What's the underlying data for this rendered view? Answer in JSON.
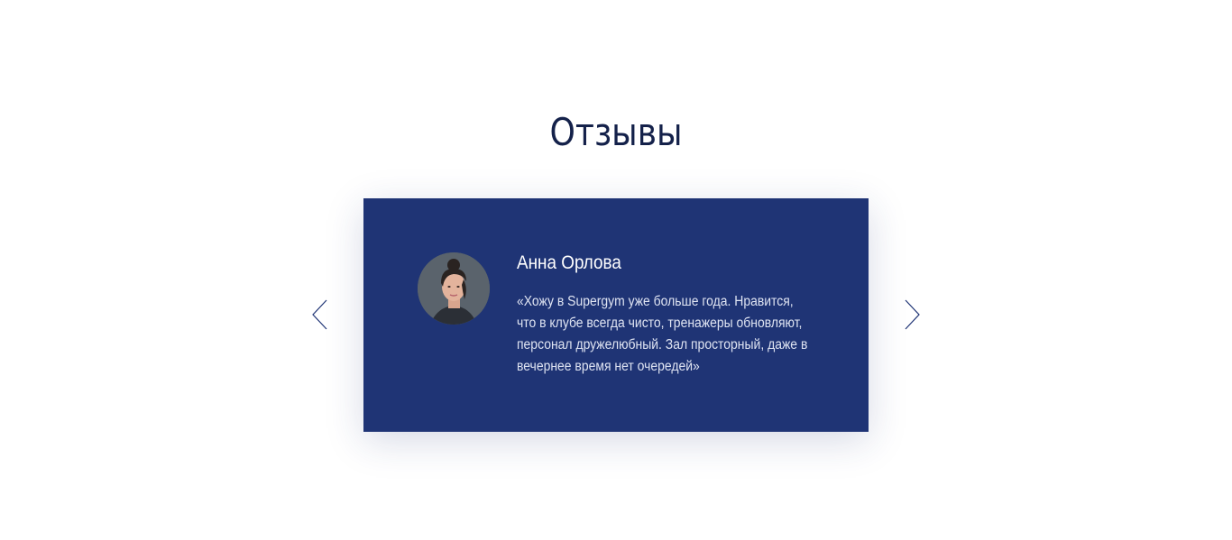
{
  "section": {
    "title": "Отзывы"
  },
  "review": {
    "author": "Анна Орлова",
    "text": "«Хожу в Supergym уже больше года. Нравится, что в клубе всегда чисто, тренажеры обновляют, персонал дружелюбный. Зал просторный, даже в вечернее время нет очередей»"
  },
  "carousel": {
    "prev_icon": "chevron-left-icon",
    "next_icon": "chevron-right-icon"
  },
  "colors": {
    "title": "#14214a",
    "card_background": "#1f3475",
    "text": "#ffffff",
    "arrow": "#1f3475"
  }
}
